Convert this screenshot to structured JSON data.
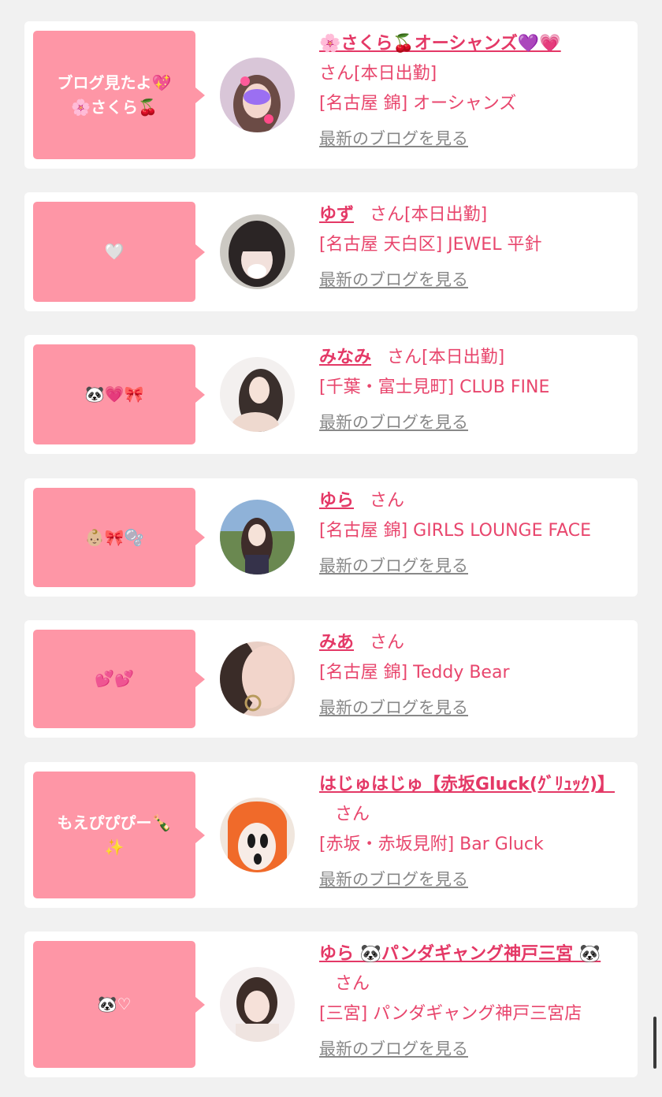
{
  "entries": [
    {
      "bubble": "ブログ見たよ💖\n🌸さくら🍒",
      "name": "🌸さくら🍒オーシャンズ💜💗",
      "suffix": "さん[本日出勤]",
      "shop": "[名古屋 錦] オーシャンズ",
      "blog": "最新のブログを見る"
    },
    {
      "bubble": "🤍",
      "name": "ゆず",
      "suffix": "さん[本日出勤]",
      "shop": "[名古屋 天白区] JEWEL 平針",
      "blog": "最新のブログを見る"
    },
    {
      "bubble": "🐼💗🎀",
      "name": "みなみ",
      "suffix": "さん[本日出勤]",
      "shop": "[千葉・富士見町] CLUB FINE",
      "blog": "最新のブログを見る"
    },
    {
      "bubble": "👶🏼🎀🫧",
      "name": "ゆら",
      "suffix": "さん",
      "shop": "[名古屋 錦] GIRLS LOUNGE FACE",
      "blog": "最新のブログを見る"
    },
    {
      "bubble": "💕💕",
      "name": "みあ",
      "suffix": "さん",
      "shop": "[名古屋 錦] Teddy Bear",
      "blog": "最新のブログを見る"
    },
    {
      "bubble": "もえぴぴぴー🍾\n✨",
      "name": "はじゅはじゅ【赤坂Gluck(ｸﾞﾘｭｯｸ)】",
      "suffix": "さん",
      "shop": "[赤坂・赤坂見附] Bar Gluck",
      "blog": "最新のブログを見る"
    },
    {
      "bubble": "🐼♡",
      "name": "ゆら 🐼パンダギャング神戸三宮 🐼",
      "suffix": "さん",
      "shop": "[三宮] パンダギャング神戸三宮店",
      "blog": "最新のブログを見る"
    }
  ]
}
